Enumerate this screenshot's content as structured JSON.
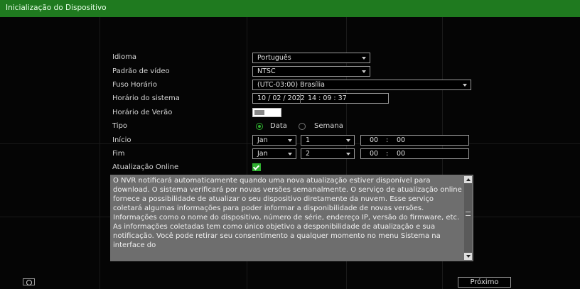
{
  "window": {
    "title": "Inicialização do Dispositivo"
  },
  "form": {
    "idioma": {
      "label": "Idioma",
      "value": "Português"
    },
    "padrao_video": {
      "label": "Padrão de vídeo",
      "value": "NTSC"
    },
    "fuso_horario": {
      "label": "Fuso Horário",
      "value": "(UTC-03:00) Brasília"
    },
    "horario_sistema": {
      "label": "Horário do sistema",
      "date": "10 / 02 / 2022",
      "time": "14 : 09 : 37"
    },
    "horario_verao": {
      "label": "Horário de Verão",
      "enabled": false
    },
    "tipo": {
      "label": "Tipo",
      "options": [
        "Data",
        "Semana"
      ],
      "selected": "Data"
    },
    "inicio": {
      "label": "Início",
      "month": "Jan",
      "day": "1",
      "time_h": "00",
      "time_sep": ":",
      "time_m": "00"
    },
    "fim": {
      "label": "Fim",
      "month": "Jan",
      "day": "2",
      "time_h": "00",
      "time_sep": ":",
      "time_m": "00"
    },
    "atualizacao_online": {
      "label": "Atualização Online",
      "checked": true
    }
  },
  "notice": {
    "text": "O NVR notificará automaticamente quando uma nova atualização estiver disponível para download. O sistema verificará por novas versões semanalmente. O serviço de atualização online fornece a possibilidade de atualizar o seu dispositivo diretamente da nuvem. Esse serviço coletará algumas informações para poder informar a disponibilidade de novas versões. Informações como o nome do dispositivo, número de série, endereço IP, versão do firmware, etc. As informações coletadas tem como único objetivo a desponibilidade de atualização e sua notificação. Você pode retirar seu consentimento a qualquer momento no menu Sistema na interface do"
  },
  "footer": {
    "next_label": "Próximo",
    "info_icon": "info-icon"
  },
  "colors": {
    "accent": "#2fae2f",
    "titlebar": "#1f7a1f",
    "notice_bg": "#6e6e6e"
  }
}
